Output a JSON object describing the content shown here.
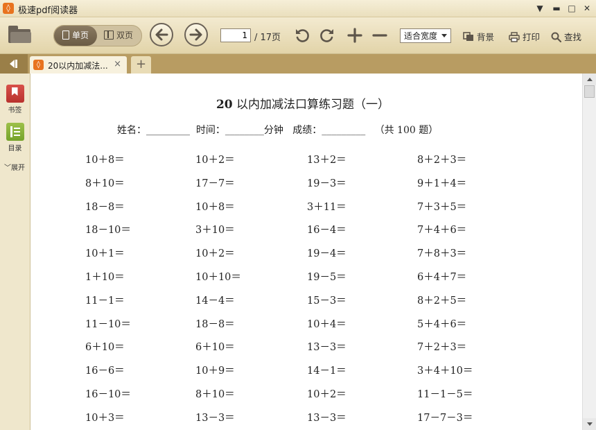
{
  "window": {
    "title": "极速pdf阅读器",
    "controls": {
      "menu": "▼",
      "minimize": "▬",
      "maximize": "□",
      "close": "✕"
    }
  },
  "toolbar": {
    "single_page_label": "单页",
    "double_page_label": "双页",
    "page_current": "1",
    "page_total": "/ 17页",
    "zoom_selected": "适合宽度",
    "background_label": "背景",
    "print_label": "打印",
    "find_label": "查找"
  },
  "tabs": {
    "document_tab_label": "20以内加减法...",
    "close_symbol": "×",
    "add_symbol": "+"
  },
  "sidebar": {
    "bookmark_label": "书签",
    "toc_label": "目录",
    "expand_label": "展开"
  },
  "document": {
    "title_num": "20",
    "title_rest": " 以内加减法口算练习题（一）",
    "subtitle": "姓名：_________  时间：________分钟   成绩：_________   （共 100 题）",
    "rows": [
      [
        "10＋8＝",
        "10＋2＝",
        "13＋2＝",
        "8＋2＋3＝"
      ],
      [
        "8＋10＝",
        "17－7＝",
        "19－3＝",
        "9＋1＋4＝"
      ],
      [
        "18－8＝",
        "10＋8＝",
        "3＋11＝",
        "7＋3＋5＝"
      ],
      [
        "18－10＝",
        "3＋10＝",
        "16－4＝",
        "7＋4＋6＝"
      ],
      [
        "10＋1＝",
        "10＋2＝",
        "19－4＝",
        "7＋8＋3＝"
      ],
      [
        "1＋10＝",
        "10＋10＝",
        "19－5＝",
        "6＋4＋7＝"
      ],
      [
        "11－1＝",
        "14－4＝",
        "15－3＝",
        "8＋2＋5＝"
      ],
      [
        "11－10＝",
        "18－8＝",
        "10＋4＝",
        "5＋4＋6＝"
      ],
      [
        "6＋10＝",
        "6＋10＝",
        "13－3＝",
        "7＋2＋3＝"
      ],
      [
        "16－6＝",
        "10＋9＝",
        "14－1＝",
        "3＋4＋10＝"
      ],
      [
        "16－10＝",
        "8＋10＝",
        "10＋2＝",
        "11－1－5＝"
      ],
      [
        "10＋3＝",
        "13－3＝",
        "13－3＝",
        "17－7－3＝"
      ]
    ]
  },
  "colors": {
    "chrome": "#e6dab3",
    "tab_strip": "#b89c62",
    "accent_logo": "#e8731f"
  }
}
